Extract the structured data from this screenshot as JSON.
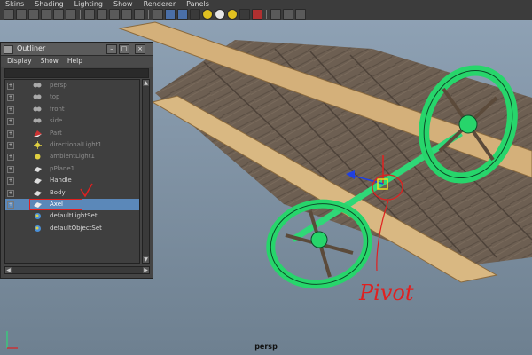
{
  "menu": [
    "Skins",
    "Shading",
    "Lighting",
    "Show",
    "Renderer",
    "Panels"
  ],
  "viewport_label": "persp",
  "outliner": {
    "title": "Outliner",
    "menu": [
      "Display",
      "Show",
      "Help"
    ],
    "items": [
      {
        "label": "persp",
        "state": "dim",
        "icon": "camera-icon"
      },
      {
        "label": "top",
        "state": "dim",
        "icon": "camera-icon"
      },
      {
        "label": "front",
        "state": "dim",
        "icon": "camera-icon"
      },
      {
        "label": "side",
        "state": "dim",
        "icon": "camera-icon"
      },
      {
        "label": "Part",
        "state": "dim",
        "icon": "mesh-icon"
      },
      {
        "label": "directionalLight1",
        "state": "dim",
        "icon": "light-icon"
      },
      {
        "label": "ambientLight1",
        "state": "dim",
        "icon": "light-icon"
      },
      {
        "label": "pPlane1",
        "state": "dim",
        "icon": "mesh-icon"
      },
      {
        "label": "Handle",
        "state": "normal",
        "icon": "mesh-icon"
      },
      {
        "label": "Body",
        "state": "normal",
        "icon": "mesh-icon"
      },
      {
        "label": "Axel",
        "state": "selected",
        "icon": "mesh-icon"
      },
      {
        "label": "defaultLightSet",
        "state": "normal",
        "icon": "set-icon"
      },
      {
        "label": "defaultObjectSet",
        "state": "normal",
        "icon": "set-icon"
      }
    ]
  },
  "annotation": {
    "text": "Pivot",
    "color": "#e02020"
  }
}
